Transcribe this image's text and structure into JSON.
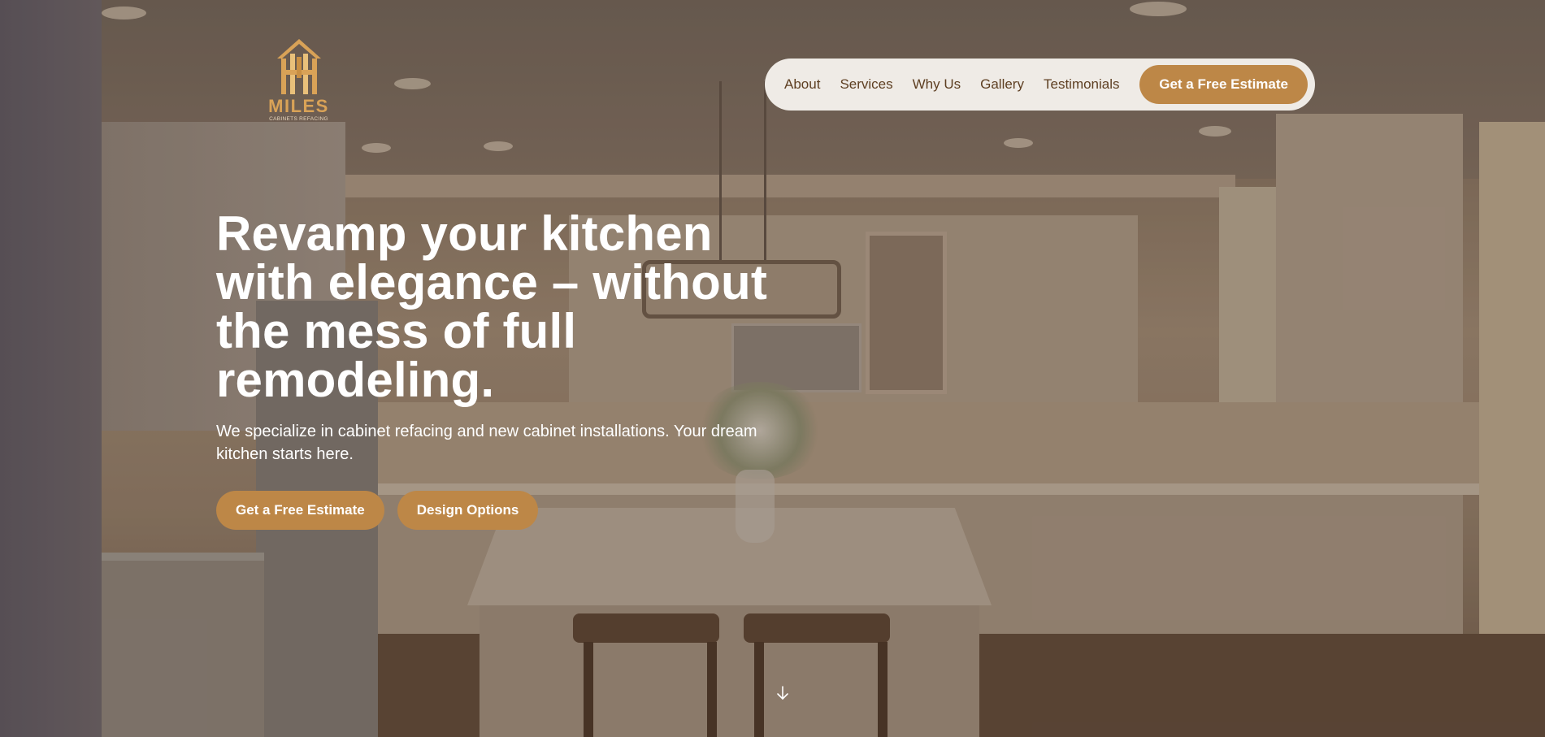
{
  "logo": {
    "brand": "MILES",
    "tagline": "CABINETS REFACING",
    "icon": "house-cabinet-logo-icon",
    "color": "#d9a257"
  },
  "nav": {
    "links": [
      "About",
      "Services",
      "Why Us",
      "Gallery",
      "Testimonials"
    ],
    "cta_label": "Get a Free Estimate"
  },
  "hero": {
    "headline_lines": [
      "Revamp your kitchen",
      "with elegance – without",
      "the mess of full",
      "remodeling."
    ],
    "subtext_lines": [
      "We specialize in cabinet refacing and new cabinet installations. Your dream",
      "kitchen starts here."
    ],
    "primary_button": "Get a Free Estimate",
    "secondary_button": "Design Options",
    "scroll_icon": "arrow-down-icon"
  },
  "colors": {
    "accent": "#bd8747",
    "nav_background": "#efebe6",
    "nav_text": "#5e3f22",
    "headline": "#ffffff"
  }
}
